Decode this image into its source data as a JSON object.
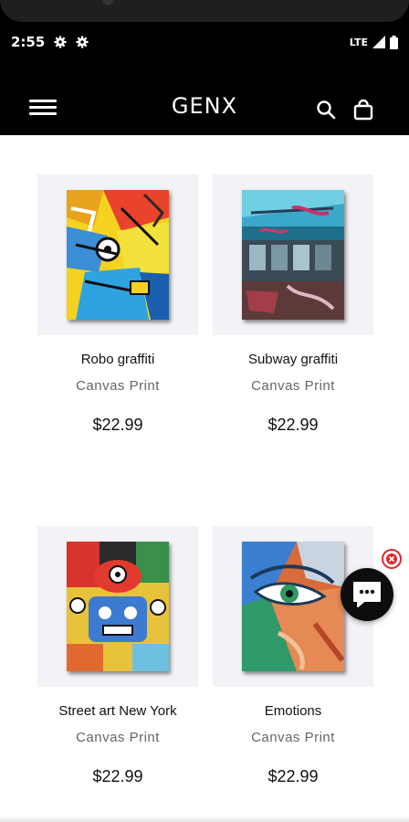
{
  "status_bar": {
    "time": "2:55",
    "network": "LTE",
    "icons": [
      "gear-icon",
      "gear-icon",
      "signal-icon",
      "battery-icon"
    ]
  },
  "header": {
    "brand": "GENX",
    "icons": [
      "menu-icon",
      "search-icon",
      "bag-icon"
    ]
  },
  "products": [
    {
      "title": "Robo graffiti",
      "subtitle": "Canvas Print",
      "price": "$22.99"
    },
    {
      "title": "Subway graffiti",
      "subtitle": "Canvas Print",
      "price": "$22.99"
    },
    {
      "title": "Street art New York",
      "subtitle": "Canvas Print",
      "price": "$22.99"
    },
    {
      "title": "Emotions",
      "subtitle": "Canvas Print",
      "price": "$22.99"
    }
  ],
  "chat_widget": {
    "icons": [
      "close-icon",
      "chat-icon"
    ],
    "accent_color": "#d9262c"
  },
  "colors": {
    "header_bg": "#000000",
    "card_bg": "#f3f2f6",
    "text": "#111111",
    "muted": "#666666"
  }
}
